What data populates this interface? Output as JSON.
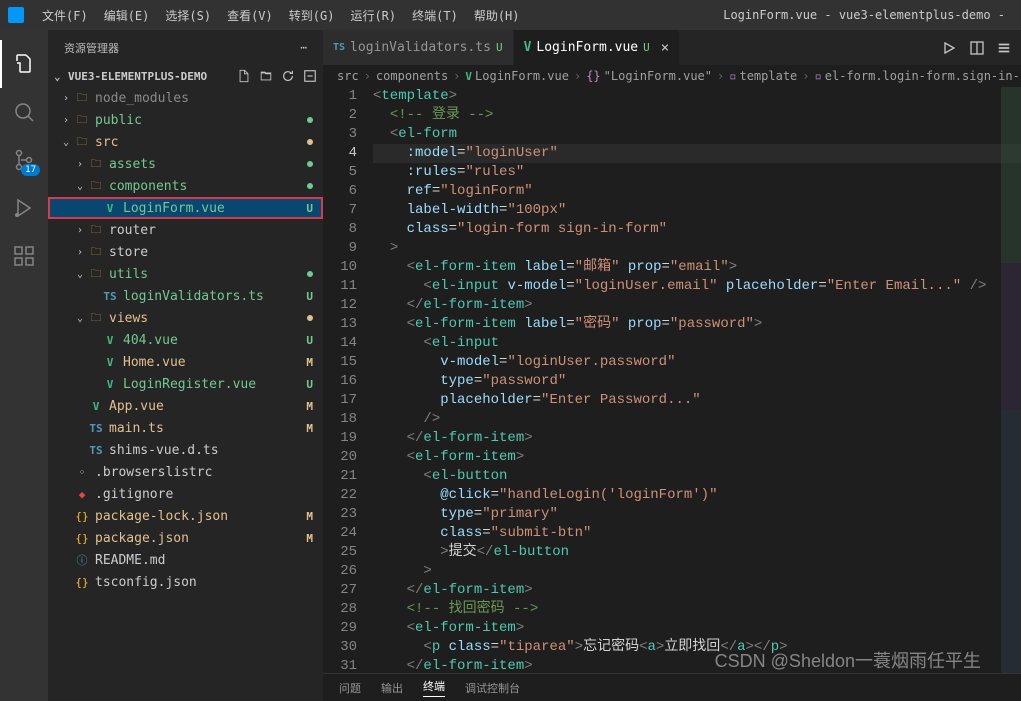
{
  "titlebar": {
    "menu": [
      "文件(F)",
      "编辑(E)",
      "选择(S)",
      "查看(V)",
      "转到(G)",
      "运行(R)",
      "终端(T)",
      "帮助(H)"
    ],
    "title": "LoginForm.vue - vue3-elementplus-demo -"
  },
  "activitybar": {
    "scm_badge": "17"
  },
  "sidebar": {
    "title": "资源管理器",
    "project": "VUE3-ELEMENTPLUS-DEMO"
  },
  "tree": [
    {
      "depth": 0,
      "chev": ">",
      "icon": "folder",
      "label": "node_modules",
      "cls": "label-dim"
    },
    {
      "depth": 0,
      "chev": ">",
      "icon": "folder",
      "label": "public",
      "cls": "label-green",
      "status": "dot-u"
    },
    {
      "depth": 0,
      "chev": "v",
      "icon": "folder",
      "label": "src",
      "cls": "label-yellow",
      "status": "dot-m"
    },
    {
      "depth": 1,
      "chev": ">",
      "icon": "folder",
      "label": "assets",
      "cls": "label-green",
      "status": "dot-u"
    },
    {
      "depth": 1,
      "chev": "v",
      "icon": "folder",
      "label": "components",
      "cls": "label-green",
      "status": "dot-u"
    },
    {
      "depth": 2,
      "chev": "",
      "icon": "vue",
      "label": "LoginForm.vue",
      "cls": "label-green",
      "status": "U",
      "active": true,
      "highlight": true
    },
    {
      "depth": 1,
      "chev": ">",
      "icon": "folder",
      "label": "router",
      "cls": ""
    },
    {
      "depth": 1,
      "chev": ">",
      "icon": "folder",
      "label": "store",
      "cls": ""
    },
    {
      "depth": 1,
      "chev": "v",
      "icon": "folder",
      "label": "utils",
      "cls": "label-green",
      "status": "dot-u"
    },
    {
      "depth": 2,
      "chev": "",
      "icon": "ts",
      "label": "loginValidators.ts",
      "cls": "label-green",
      "status": "U"
    },
    {
      "depth": 1,
      "chev": "v",
      "icon": "folder",
      "label": "views",
      "cls": "label-yellow",
      "status": "dot-m"
    },
    {
      "depth": 2,
      "chev": "",
      "icon": "vue",
      "label": "404.vue",
      "cls": "label-green",
      "status": "U"
    },
    {
      "depth": 2,
      "chev": "",
      "icon": "vue",
      "label": "Home.vue",
      "cls": "label-yellow",
      "status": "M"
    },
    {
      "depth": 2,
      "chev": "",
      "icon": "vue",
      "label": "LoginRegister.vue",
      "cls": "label-green",
      "status": "U"
    },
    {
      "depth": 1,
      "chev": "",
      "icon": "vue",
      "label": "App.vue",
      "cls": "label-yellow",
      "status": "M"
    },
    {
      "depth": 1,
      "chev": "",
      "icon": "ts",
      "label": "main.ts",
      "cls": "label-yellow",
      "status": "M"
    },
    {
      "depth": 1,
      "chev": "",
      "icon": "ts",
      "label": "shims-vue.d.ts",
      "cls": ""
    },
    {
      "depth": 0,
      "chev": "",
      "icon": "",
      "label": ".browserslistrc",
      "cls": ""
    },
    {
      "depth": 0,
      "chev": "",
      "icon": "git",
      "label": ".gitignore",
      "cls": ""
    },
    {
      "depth": 0,
      "chev": "",
      "icon": "json",
      "label": "package-lock.json",
      "cls": "label-yellow",
      "status": "M"
    },
    {
      "depth": 0,
      "chev": "",
      "icon": "json",
      "label": "package.json",
      "cls": "label-yellow",
      "status": "M"
    },
    {
      "depth": 0,
      "chev": "",
      "icon": "md",
      "label": "README.md",
      "cls": ""
    },
    {
      "depth": 0,
      "chev": "",
      "icon": "json",
      "label": "tsconfig.json",
      "cls": ""
    }
  ],
  "tabs": [
    {
      "icon": "ts",
      "label": "loginValidators.ts",
      "status": "U",
      "active": false
    },
    {
      "icon": "vue",
      "label": "LoginForm.vue",
      "status": "U",
      "active": true,
      "close": true
    }
  ],
  "breadcrumb": [
    {
      "t": "src"
    },
    {
      "t": "components"
    },
    {
      "i": "vue",
      "t": "LoginForm.vue"
    },
    {
      "i": "brace",
      "t": "\"LoginForm.vue\""
    },
    {
      "i": "cube",
      "t": "template"
    },
    {
      "i": "cube",
      "t": "el-form.login-form.sign-in-form"
    }
  ],
  "code": [
    {
      "n": 1,
      "h": "<span class='tok-brkt'>&lt;</span><span class='tok-tag'>template</span><span class='tok-brkt'>&gt;</span>"
    },
    {
      "n": 2,
      "h": "  <span class='tok-cmt'>&lt;!-- 登录 --&gt;</span>"
    },
    {
      "n": 3,
      "h": "  <span class='tok-brkt'>&lt;</span><span class='tok-tag'>el-form</span>"
    },
    {
      "n": 4,
      "cur": true,
      "hl": true,
      "h": "    <span class='tok-attr'>:model</span><span class='tok-txt'>=</span><span class='tok-str'>\"loginUser\"</span>"
    },
    {
      "n": 5,
      "h": "    <span class='tok-attr'>:rules</span><span class='tok-txt'>=</span><span class='tok-str'>\"rules\"</span>"
    },
    {
      "n": 6,
      "h": "    <span class='tok-attr'>ref</span><span class='tok-txt'>=</span><span class='tok-str'>\"loginForm\"</span>"
    },
    {
      "n": 7,
      "h": "    <span class='tok-attr'>label-width</span><span class='tok-txt'>=</span><span class='tok-str'>\"100px\"</span>"
    },
    {
      "n": 8,
      "h": "    <span class='tok-attr'>class</span><span class='tok-txt'>=</span><span class='tok-str'>\"login-form sign-in-form\"</span>"
    },
    {
      "n": 9,
      "h": "  <span class='tok-brkt'>&gt;</span>"
    },
    {
      "n": 10,
      "h": "    <span class='tok-brkt'>&lt;</span><span class='tok-tag'>el-form-item</span> <span class='tok-attr'>label</span><span class='tok-txt'>=</span><span class='tok-str'>\"邮箱\"</span> <span class='tok-attr'>prop</span><span class='tok-txt'>=</span><span class='tok-str'>\"email\"</span><span class='tok-brkt'>&gt;</span>"
    },
    {
      "n": 11,
      "h": "      <span class='tok-brkt'>&lt;</span><span class='tok-tag'>el-input</span> <span class='tok-attr'>v-model</span><span class='tok-txt'>=</span><span class='tok-str'>\"loginUser.email\"</span> <span class='tok-attr'>placeholder</span><span class='tok-txt'>=</span><span class='tok-str'>\"Enter Email...\"</span> <span class='tok-brkt'>/&gt;</span>"
    },
    {
      "n": 12,
      "h": "    <span class='tok-brkt'>&lt;/</span><span class='tok-tag'>el-form-item</span><span class='tok-brkt'>&gt;</span>"
    },
    {
      "n": 13,
      "h": "    <span class='tok-brkt'>&lt;</span><span class='tok-tag'>el-form-item</span> <span class='tok-attr'>label</span><span class='tok-txt'>=</span><span class='tok-str'>\"密码\"</span> <span class='tok-attr'>prop</span><span class='tok-txt'>=</span><span class='tok-str'>\"password\"</span><span class='tok-brkt'>&gt;</span>"
    },
    {
      "n": 14,
      "h": "      <span class='tok-brkt'>&lt;</span><span class='tok-tag'>el-input</span>"
    },
    {
      "n": 15,
      "h": "        <span class='tok-attr'>v-model</span><span class='tok-txt'>=</span><span class='tok-str'>\"loginUser.password\"</span>"
    },
    {
      "n": 16,
      "h": "        <span class='tok-attr'>type</span><span class='tok-txt'>=</span><span class='tok-str'>\"password\"</span>"
    },
    {
      "n": 17,
      "h": "        <span class='tok-attr'>placeholder</span><span class='tok-txt'>=</span><span class='tok-str'>\"Enter Password...\"</span>"
    },
    {
      "n": 18,
      "h": "      <span class='tok-brkt'>/&gt;</span>"
    },
    {
      "n": 19,
      "h": "    <span class='tok-brkt'>&lt;/</span><span class='tok-tag'>el-form-item</span><span class='tok-brkt'>&gt;</span>"
    },
    {
      "n": 20,
      "h": "    <span class='tok-brkt'>&lt;</span><span class='tok-tag'>el-form-item</span><span class='tok-brkt'>&gt;</span>"
    },
    {
      "n": 21,
      "h": "      <span class='tok-brkt'>&lt;</span><span class='tok-tag'>el-button</span>"
    },
    {
      "n": 22,
      "h": "        <span class='tok-attr'>@click</span><span class='tok-txt'>=</span><span class='tok-str'>\"handleLogin('loginForm')\"</span>"
    },
    {
      "n": 23,
      "h": "        <span class='tok-attr'>type</span><span class='tok-txt'>=</span><span class='tok-str'>\"primary\"</span>"
    },
    {
      "n": 24,
      "h": "        <span class='tok-attr'>class</span><span class='tok-txt'>=</span><span class='tok-str'>\"submit-btn\"</span>"
    },
    {
      "n": 25,
      "h": "        <span class='tok-brkt'>&gt;</span><span class='tok-txt'>提交</span><span class='tok-brkt'>&lt;/</span><span class='tok-tag'>el-button</span>"
    },
    {
      "n": 26,
      "h": "      <span class='tok-brkt'>&gt;</span>"
    },
    {
      "n": 27,
      "h": "    <span class='tok-brkt'>&lt;/</span><span class='tok-tag'>el-form-item</span><span class='tok-brkt'>&gt;</span>"
    },
    {
      "n": 28,
      "h": "    <span class='tok-cmt'>&lt;!-- 找回密码 --&gt;</span>"
    },
    {
      "n": 29,
      "h": "    <span class='tok-brkt'>&lt;</span><span class='tok-tag'>el-form-item</span><span class='tok-brkt'>&gt;</span>"
    },
    {
      "n": 30,
      "h": "      <span class='tok-brkt'>&lt;</span><span class='tok-tag'>p</span> <span class='tok-attr'>class</span><span class='tok-txt'>=</span><span class='tok-str'>\"tiparea\"</span><span class='tok-brkt'>&gt;</span><span class='tok-txt'>忘记密码</span><span class='tok-brkt'>&lt;</span><span class='tok-tag'>a</span><span class='tok-brkt'>&gt;</span><span class='tok-txt'>立即找回</span><span class='tok-brkt'>&lt;/</span><span class='tok-tag'>a</span><span class='tok-brkt'>&gt;&lt;/</span><span class='tok-tag'>p</span><span class='tok-brkt'>&gt;</span>"
    },
    {
      "n": 31,
      "h": "    <span class='tok-brkt'>&lt;/</span><span class='tok-tag'>el-form-item</span><span class='tok-brkt'>&gt;</span>"
    }
  ],
  "panel": {
    "tabs": [
      "问题",
      "输出",
      "终端",
      "调试控制台"
    ],
    "active": 2
  },
  "watermark": "CSDN @Sheldon一蓑烟雨任平生"
}
